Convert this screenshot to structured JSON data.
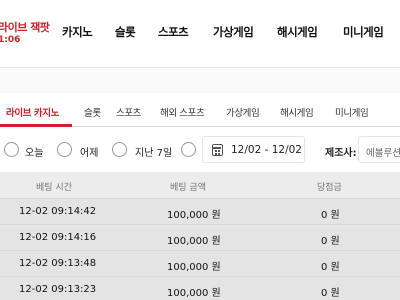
{
  "brand": {
    "line1": "라이브 잭팟",
    "line2": "1:06",
    "color": "#d0202b"
  },
  "nav": [
    "카지노",
    "슬롯",
    "스포츠",
    "가상게임",
    "해시게임",
    "미니게임"
  ],
  "tabs": [
    "라이브 카지노",
    "슬롯",
    "스포츠",
    "해외 스포츠",
    "가상게임",
    "해시게임",
    "미니게임"
  ],
  "active_tab": "라이브 카지노",
  "filters": {
    "options": [
      "오늘",
      "어제",
      "지난 7일",
      ""
    ],
    "date_range": "12/02 - 12/02",
    "provider_label": "제조사:",
    "provider_value": "에볼루션"
  },
  "table": {
    "headers": [
      "베팅 시간",
      "베팅 금액",
      "당첨금"
    ],
    "rows": [
      [
        "12-02 09:14:42",
        "100,000 원",
        "0 원"
      ],
      [
        "12-02 09:14:16",
        "100,000 원",
        "0 원"
      ],
      [
        "12-02 09:13:48",
        "100,000 원",
        "0 원"
      ],
      [
        "12-02 09:13:23",
        "100,000 원",
        "0 원"
      ]
    ]
  },
  "icons": {
    "calendar": "calendar-icon"
  }
}
